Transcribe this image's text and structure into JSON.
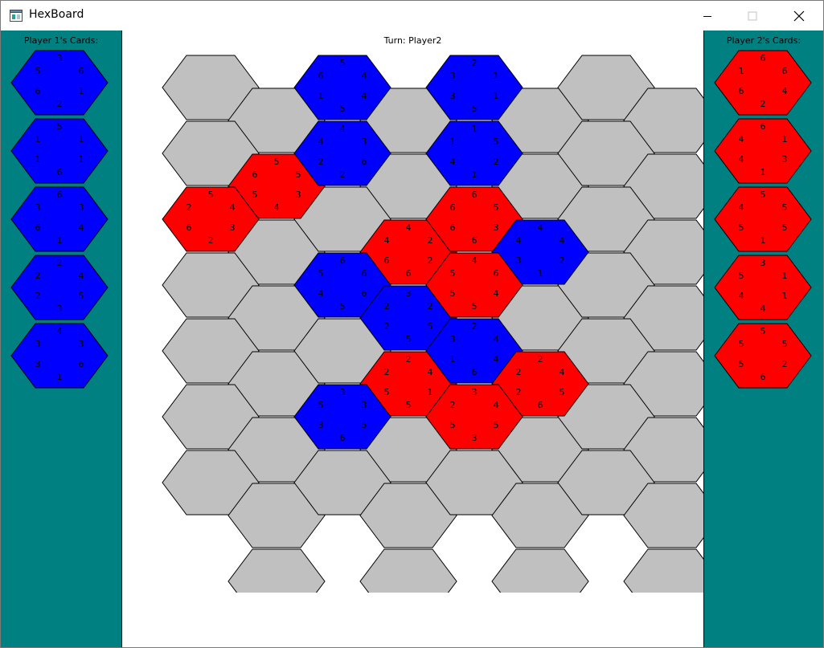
{
  "window": {
    "title": "HexBoard",
    "icon": "app-window-icon",
    "controls": [
      "minimize-icon",
      "maximize-icon",
      "close-icon"
    ]
  },
  "turn_label": "Turn: Player2",
  "colors": {
    "sidebar": "#008080",
    "blue": "#0000ff",
    "red": "#ff0000",
    "empty": "#c0c0c0"
  },
  "player1": {
    "title": "Player 1's Cards:",
    "cards": [
      {
        "color": "blue",
        "values": [
          3,
          6,
          1,
          2,
          6,
          5
        ]
      },
      {
        "color": "blue",
        "values": [
          5,
          1,
          1,
          6,
          1,
          1
        ]
      },
      {
        "color": "blue",
        "values": [
          6,
          3,
          4,
          1,
          6,
          3
        ]
      },
      {
        "color": "blue",
        "values": [
          2,
          4,
          5,
          3,
          2,
          2
        ]
      },
      {
        "color": "blue",
        "values": [
          4,
          3,
          6,
          1,
          3,
          3
        ]
      }
    ]
  },
  "player2": {
    "title": "Player 2's Cards:",
    "cards": [
      {
        "color": "red",
        "values": [
          6,
          6,
          4,
          2,
          6,
          1
        ]
      },
      {
        "color": "red",
        "values": [
          6,
          1,
          3,
          1,
          4,
          4
        ]
      },
      {
        "color": "red",
        "values": [
          5,
          5,
          5,
          1,
          5,
          4
        ]
      },
      {
        "color": "red",
        "values": [
          3,
          1,
          1,
          4,
          4,
          5
        ]
      },
      {
        "color": "red",
        "values": [
          5,
          5,
          2,
          6,
          5,
          5
        ]
      }
    ]
  },
  "board": {
    "rows": 8,
    "cols": 8,
    "cells": [
      {
        "row": 0,
        "col": 2,
        "color": "blue",
        "values": [
          5,
          4,
          4,
          5,
          1,
          6
        ]
      },
      {
        "row": 0,
        "col": 4,
        "color": "blue",
        "values": [
          2,
          1,
          1,
          5,
          3,
          3
        ]
      },
      {
        "row": 1,
        "col": 2,
        "color": "blue",
        "values": [
          4,
          3,
          6,
          2,
          2,
          4
        ]
      },
      {
        "row": 1,
        "col": 1,
        "color": "red",
        "values": [
          5,
          5,
          3,
          4,
          5,
          6
        ]
      },
      {
        "row": 1,
        "col": 4,
        "color": "blue",
        "values": [
          1,
          5,
          2,
          1,
          4,
          1
        ]
      },
      {
        "row": 2,
        "col": 0,
        "color": "red",
        "values": [
          5,
          4,
          3,
          2,
          6,
          2
        ]
      },
      {
        "row": 2,
        "col": 4,
        "color": "red",
        "values": [
          6,
          5,
          3,
          6,
          6,
          6
        ]
      },
      {
        "row": 2,
        "col": 3,
        "color": "red",
        "values": [
          4,
          2,
          2,
          6,
          6,
          4
        ]
      },
      {
        "row": 2,
        "col": 5,
        "color": "blue",
        "values": [
          4,
          4,
          2,
          1,
          3,
          4
        ]
      },
      {
        "row": 3,
        "col": 2,
        "color": "blue",
        "values": [
          6,
          6,
          6,
          5,
          4,
          5
        ]
      },
      {
        "row": 3,
        "col": 4,
        "color": "red",
        "values": [
          4,
          6,
          4,
          5,
          5,
          5
        ]
      },
      {
        "row": 3,
        "col": 3,
        "color": "blue",
        "values": [
          3,
          2,
          5,
          5,
          2,
          2
        ]
      },
      {
        "row": 4,
        "col": 4,
        "color": "blue",
        "values": [
          2,
          4,
          4,
          6,
          1,
          3
        ]
      },
      {
        "row": 4,
        "col": 3,
        "color": "red",
        "values": [
          2,
          4,
          1,
          5,
          5,
          2
        ]
      },
      {
        "row": 4,
        "col": 5,
        "color": "red",
        "values": [
          2,
          4,
          5,
          6,
          2,
          2
        ]
      },
      {
        "row": 5,
        "col": 2,
        "color": "blue",
        "values": [
          3,
          3,
          5,
          6,
          3,
          5
        ]
      },
      {
        "row": 5,
        "col": 4,
        "color": "red",
        "values": [
          3,
          4,
          5,
          3,
          5,
          2
        ]
      }
    ]
  }
}
